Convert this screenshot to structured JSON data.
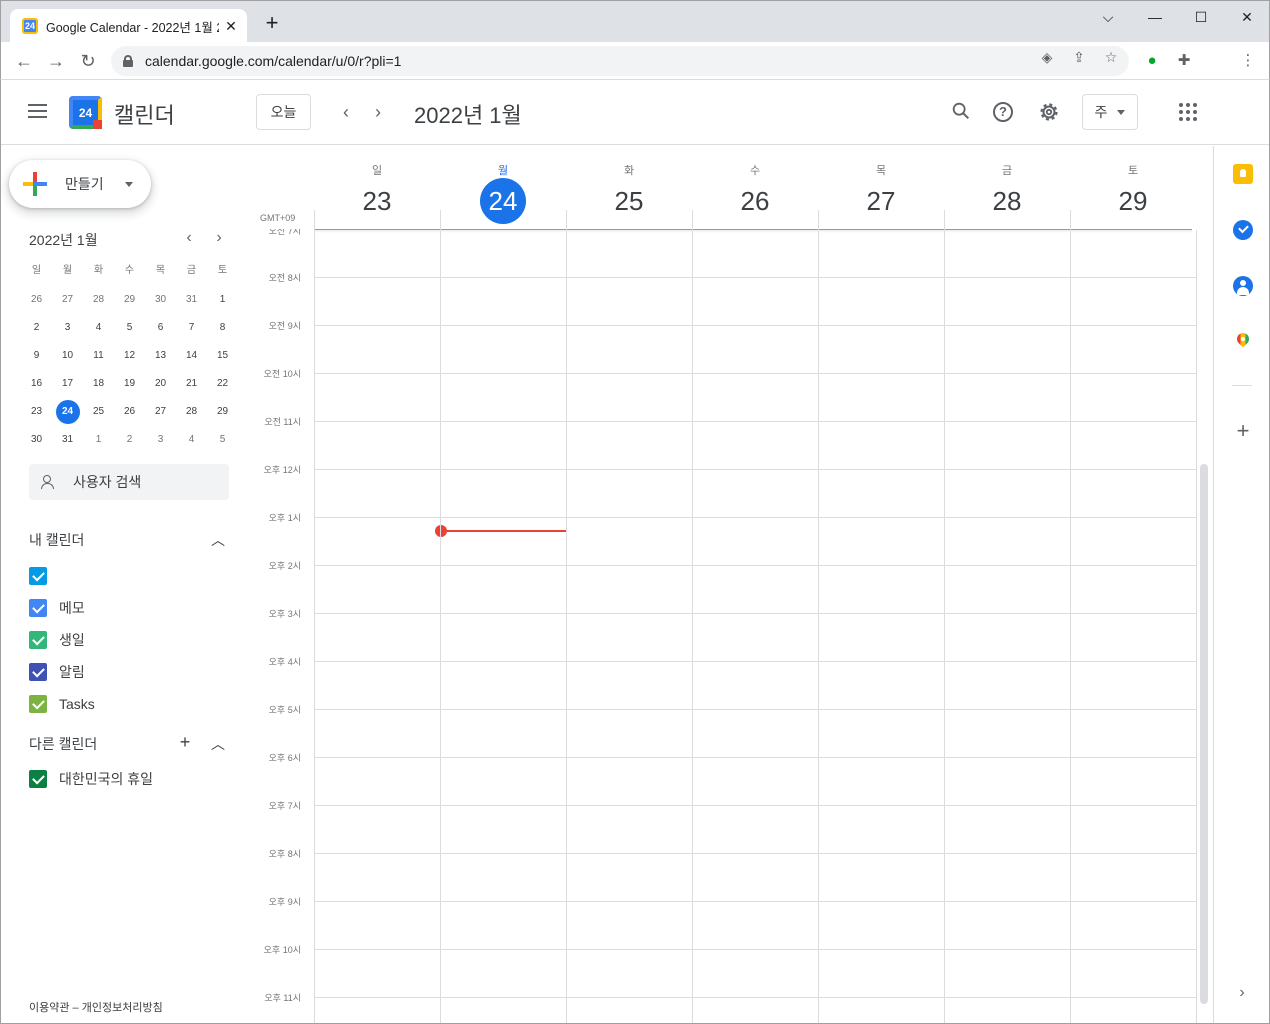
{
  "browser": {
    "tab_title": "Google Calendar - 2022년 1월 2",
    "tab_favicon_text": "24",
    "url": "calendar.google.com/calendar/u/0/r?pli=1"
  },
  "header": {
    "app_title": "캘린더",
    "logo_day": "24",
    "today_label": "오늘",
    "period_title": "2022년 1월",
    "view_label": "주"
  },
  "sidebar": {
    "create_label": "만들기",
    "mini_cal": {
      "title": "2022년 1월",
      "weekdays": [
        "일",
        "월",
        "화",
        "수",
        "목",
        "금",
        "토"
      ],
      "weeks": [
        [
          "26",
          "27",
          "28",
          "29",
          "30",
          "31",
          "1"
        ],
        [
          "2",
          "3",
          "4",
          "5",
          "6",
          "7",
          "8"
        ],
        [
          "9",
          "10",
          "11",
          "12",
          "13",
          "14",
          "15"
        ],
        [
          "16",
          "17",
          "18",
          "19",
          "20",
          "21",
          "22"
        ],
        [
          "23",
          "24",
          "25",
          "26",
          "27",
          "28",
          "29"
        ],
        [
          "30",
          "31",
          "1",
          "2",
          "3",
          "4",
          "5"
        ]
      ],
      "selected": "24"
    },
    "people_search": "사용자 검색",
    "my_calendars_title": "내 캘린더",
    "my_calendars": [
      {
        "label": "",
        "color": "#039be5"
      },
      {
        "label": "메모",
        "color": "#4285f4"
      },
      {
        "label": "생일",
        "color": "#33b679"
      },
      {
        "label": "알림",
        "color": "#3f51b5"
      },
      {
        "label": "Tasks",
        "color": "#7cb342"
      }
    ],
    "other_calendars_title": "다른 캘린더",
    "other_calendars": [
      {
        "label": "대한민국의 휴일",
        "color": "#0b8043"
      }
    ],
    "footer_terms": "이용약관",
    "footer_sep": "–",
    "footer_privacy": "개인정보처리방침"
  },
  "week": {
    "timezone": "GMT+09",
    "days": [
      {
        "dow": "일",
        "date": "23"
      },
      {
        "dow": "월",
        "date": "24",
        "today": true
      },
      {
        "dow": "화",
        "date": "25"
      },
      {
        "dow": "수",
        "date": "26"
      },
      {
        "dow": "목",
        "date": "27"
      },
      {
        "dow": "금",
        "date": "28"
      },
      {
        "dow": "토",
        "date": "29"
      }
    ],
    "hours": [
      "오전 7시",
      "오전 8시",
      "오전 9시",
      "오전 10시",
      "오전 11시",
      "오후 12시",
      "오후 1시",
      "오후 2시",
      "오후 3시",
      "오후 4시",
      "오후 5시",
      "오후 6시",
      "오후 7시",
      "오후 8시",
      "오후 9시",
      "오후 10시",
      "오후 11시"
    ]
  },
  "colors": {
    "accent": "#1a73e8",
    "now_indicator": "#ea4335"
  },
  "icons": [
    "menu-icon",
    "search-icon",
    "help-icon",
    "settings-icon",
    "apps-icon",
    "keep-icon",
    "tasks-icon",
    "contacts-icon",
    "maps-icon"
  ]
}
